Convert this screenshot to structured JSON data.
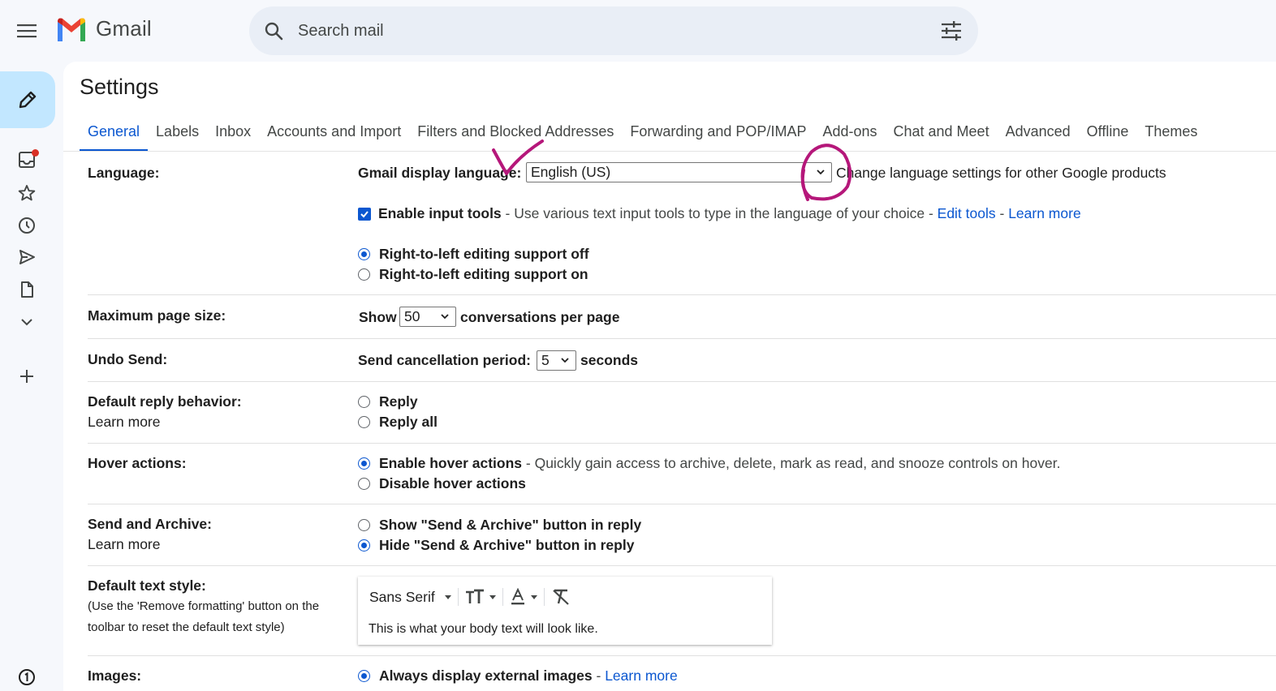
{
  "app": {
    "name": "Gmail"
  },
  "search": {
    "placeholder": "Search mail"
  },
  "page": {
    "title": "Settings"
  },
  "tabs": [
    {
      "label": "General",
      "active": true
    },
    {
      "label": "Labels"
    },
    {
      "label": "Inbox"
    },
    {
      "label": "Accounts and Import"
    },
    {
      "label": "Filters and Blocked Addresses"
    },
    {
      "label": "Forwarding and POP/IMAP"
    },
    {
      "label": "Add-ons"
    },
    {
      "label": "Chat and Meet"
    },
    {
      "label": "Advanced"
    },
    {
      "label": "Offline"
    },
    {
      "label": "Themes"
    }
  ],
  "settings": {
    "language": {
      "label": "Language:",
      "display_label": "Gmail display language:",
      "display_value": "English (US)",
      "change_link": "Change language settings for other Google products",
      "input_tools_label": "Enable input tools",
      "input_tools_desc": " - Use various text input tools to type in the language of your choice - ",
      "edit_tools": "Edit tools",
      "dash": " - ",
      "learn_more": "Learn more",
      "rtl_off": "Right-to-left editing support off",
      "rtl_on": "Right-to-left editing support on"
    },
    "page_size": {
      "label": "Maximum page size:",
      "show": "Show",
      "value": "50",
      "suffix": "conversations per page"
    },
    "undo_send": {
      "label": "Undo Send:",
      "prefix": "Send cancellation period:",
      "value": "5",
      "suffix": "seconds"
    },
    "reply": {
      "label": "Default reply behavior:",
      "learn_more": "Learn more",
      "opt1": "Reply",
      "opt2": "Reply all"
    },
    "hover": {
      "label": "Hover actions:",
      "enable": "Enable hover actions",
      "enable_desc": " - Quickly gain access to archive, delete, mark as read, and snooze controls on hover.",
      "disable": "Disable hover actions"
    },
    "send_archive": {
      "label": "Send and Archive:",
      "learn_more": "Learn more",
      "show": "Show \"Send & Archive\" button in reply",
      "hide": "Hide \"Send & Archive\" button in reply"
    },
    "text_style": {
      "label": "Default text style:",
      "note_line1": "(Use the 'Remove formatting' button on the",
      "note_line2": "toolbar to reset the default text style)",
      "font": "Sans Serif",
      "preview": "This is what your body text will look like."
    },
    "images": {
      "label": "Images:",
      "always": "Always display external images",
      "dash": " - ",
      "learn_more": "Learn more"
    }
  },
  "colors": {
    "accent": "#0b57d0",
    "compose_bg": "#c2e7ff",
    "annotation": "#b5177a",
    "badge": "#d93025"
  }
}
